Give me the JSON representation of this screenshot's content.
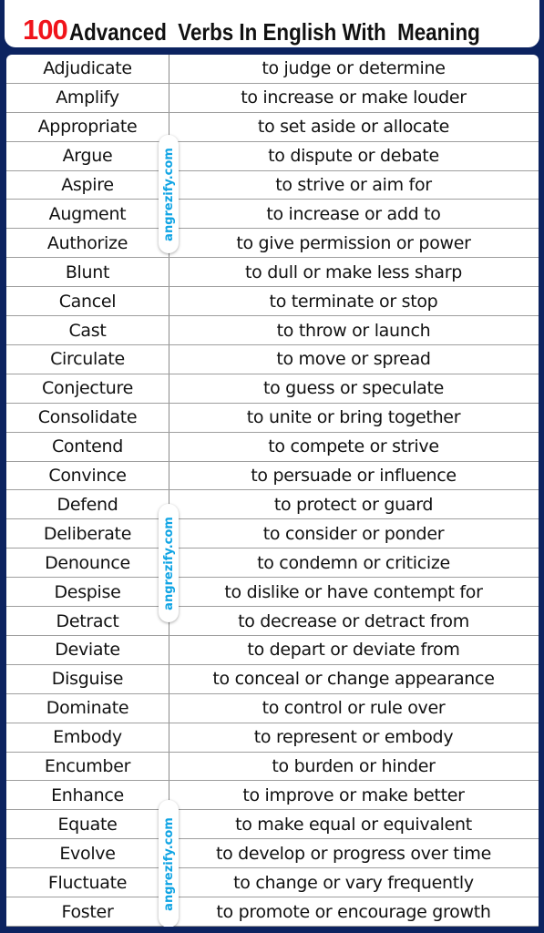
{
  "title": {
    "number": "100",
    "text": "Advanced  Verbs In English With  Meaning"
  },
  "watermark": "angrezify.com",
  "rows": [
    {
      "verb": "Adjudicate",
      "meaning": "to judge or determine"
    },
    {
      "verb": "Amplify",
      "meaning": "to increase or make louder"
    },
    {
      "verb": "Appropriate",
      "meaning": "to set aside or allocate"
    },
    {
      "verb": "Argue",
      "meaning": "to dispute or debate"
    },
    {
      "verb": "Aspire",
      "meaning": "to strive or aim for"
    },
    {
      "verb": "Augment",
      "meaning": "to increase or add to"
    },
    {
      "verb": "Authorize",
      "meaning": "to give permission or power"
    },
    {
      "verb": "Blunt",
      "meaning": "to dull or make less sharp"
    },
    {
      "verb": "Cancel",
      "meaning": "to terminate or stop"
    },
    {
      "verb": "Cast",
      "meaning": "to throw or launch"
    },
    {
      "verb": "Circulate",
      "meaning": "to move or spread"
    },
    {
      "verb": "Conjecture",
      "meaning": "to guess or speculate"
    },
    {
      "verb": "Consolidate",
      "meaning": "to unite or bring together"
    },
    {
      "verb": "Contend",
      "meaning": "to compete or strive"
    },
    {
      "verb": "Convince",
      "meaning": "to persuade or influence"
    },
    {
      "verb": "Defend",
      "meaning": "to protect or guard"
    },
    {
      "verb": "Deliberate",
      "meaning": "to consider or ponder"
    },
    {
      "verb": "Denounce",
      "meaning": "to condemn or criticize"
    },
    {
      "verb": "Despise",
      "meaning": "to dislike or have contempt for"
    },
    {
      "verb": "Detract",
      "meaning": "to decrease or detract from"
    },
    {
      "verb": "Deviate",
      "meaning": "to depart or deviate from"
    },
    {
      "verb": "Disguise",
      "meaning": "to conceal or change appearance"
    },
    {
      "verb": "Dominate",
      "meaning": "to control or rule over"
    },
    {
      "verb": "Embody",
      "meaning": "to represent or embody"
    },
    {
      "verb": "Encumber",
      "meaning": "to burden or hinder"
    },
    {
      "verb": "Enhance",
      "meaning": "to improve or make better"
    },
    {
      "verb": "Equate",
      "meaning": "to make equal or equivalent"
    },
    {
      "verb": "Evolve",
      "meaning": "to develop or progress over time"
    },
    {
      "verb": "Fluctuate",
      "meaning": "to change or vary frequently"
    },
    {
      "verb": "Foster",
      "meaning": "to promote or encourage growth"
    }
  ]
}
